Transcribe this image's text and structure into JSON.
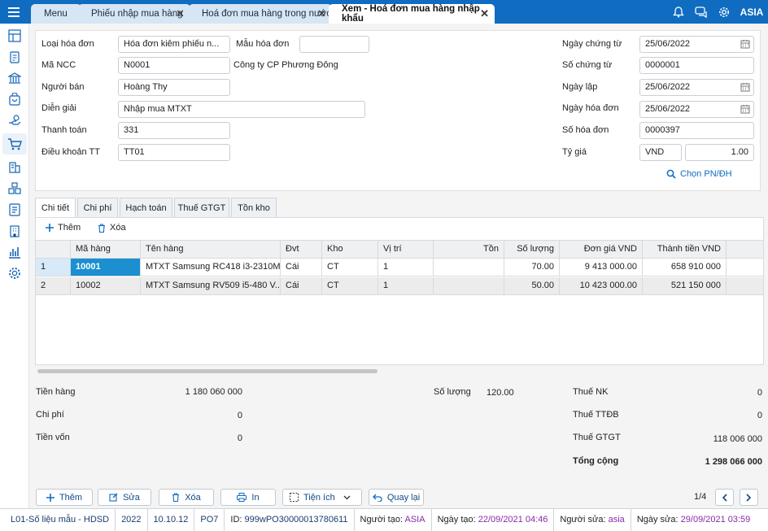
{
  "topbar": {
    "tabs": [
      {
        "label": "Menu"
      },
      {
        "label": "Phiếu nhập mua hàng"
      },
      {
        "label": "Hoá đơn mua hàng trong nước"
      },
      {
        "label": "Xem - Hoá đơn mua hàng nhập khẩu"
      }
    ],
    "user": "ASIA"
  },
  "form": {
    "loai_hoa_don_label": "Loại hóa đơn",
    "loai_hoa_don": "Hóa đơn kiêm phiếu n...",
    "mau_hoa_don_label": "Mẫu hóa đơn",
    "mau_hoa_don": "",
    "ma_ncc_label": "Mã NCC",
    "ma_ncc": "N0001",
    "ten_ncc": "Công ty CP Phương Đông",
    "nguoi_ban_label": "Người bán",
    "nguoi_ban": "Hoàng Thy",
    "dien_giai_label": "Diễn giải",
    "dien_giai": "Nhập mua MTXT",
    "thanh_toan_label": "Thanh toán",
    "thanh_toan": "331",
    "dieu_khoan_label": "Điều khoản TT",
    "dieu_khoan": "TT01",
    "ngay_chung_tu_label": "Ngày chứng từ",
    "ngay_chung_tu": "25/06/2022",
    "so_chung_tu_label": "Số chứng từ",
    "so_chung_tu": "0000001",
    "ngay_lap_label": "Ngày lập",
    "ngay_lap": "25/06/2022",
    "ngay_hoa_don_label": "Ngày hóa đơn",
    "ngay_hoa_don": "25/06/2022",
    "so_hoa_don_label": "Số hóa đơn",
    "so_hoa_don": "0000397",
    "ty_gia_label": "Tỷ giá",
    "currency": "VND",
    "ty_gia": "1.00",
    "chon_pn_dh": "Chọn PN/ĐH"
  },
  "detail_tabs": [
    "Chi tiết",
    "Chi phí",
    "Hạch toán",
    "Thuế GTGT",
    "Tồn kho"
  ],
  "grid": {
    "add_label": "Thêm",
    "delete_label": "Xóa",
    "columns": [
      "",
      "Mã hàng",
      "Tên hàng",
      "Đvt",
      "Kho",
      "Vị trí",
      "Tồn",
      "Số lượng",
      "Đơn giá VND",
      "Thành tiền VND"
    ],
    "rows": [
      [
        "1",
        "10001",
        "MTXT Samsung RC418 i3-2310M...",
        "Cái",
        "CT",
        "1",
        "",
        "70.00",
        "9 413 000.00",
        "658 910 000"
      ],
      [
        "2",
        "10002",
        "MTXT Samsung RV509 i5-480 V...",
        "Cái",
        "CT",
        "1",
        "",
        "50.00",
        "10 423 000.00",
        "521 150 000"
      ]
    ]
  },
  "summary": {
    "tien_hang_label": "Tiền hàng",
    "tien_hang": "1 180 060 000",
    "chi_phi_label": "Chi phí",
    "chi_phi": "0",
    "tien_von_label": "Tiền vốn",
    "tien_von": "0",
    "so_luong_label": "Số lượng",
    "so_luong": "120.00",
    "thue_nk_label": "Thuế NK",
    "thue_nk": "0",
    "thue_ttdb_label": "Thuế TTĐB",
    "thue_ttdb": "0",
    "thue_gtgt_label": "Thuế GTGT",
    "thue_gtgt": "118 006 000",
    "tong_cong_label": "Tổng cộng",
    "tong_cong": "1 298 066 000"
  },
  "actions": {
    "them": "Thêm",
    "sua": "Sửa",
    "xoa": "Xóa",
    "in": "In",
    "tien_ich": "Tiện ích",
    "quay_lai": "Quay lại",
    "page": "1/4"
  },
  "status": {
    "db": "L01-Số liệu mẫu - HDSD",
    "year": "2022",
    "version": "10.10.12",
    "code": "PO7",
    "id_label": "ID:",
    "id": "999wPO30000013780611",
    "nguoi_tao_label": "Người tạo:",
    "nguoi_tao": "ASIA",
    "ngay_tao_label": "Ngày tạo:",
    "ngay_tao": "22/09/2021 04:46",
    "nguoi_sua_label": "Người sửa:",
    "nguoi_sua": "asia",
    "ngay_sua_label": "Ngày sửa:",
    "ngay_sua": "29/09/2021 03:59"
  },
  "colors": {
    "brand": "#0f6cc0",
    "selected_cell": "#1b8fd0",
    "purple": "#8a2aa8"
  }
}
